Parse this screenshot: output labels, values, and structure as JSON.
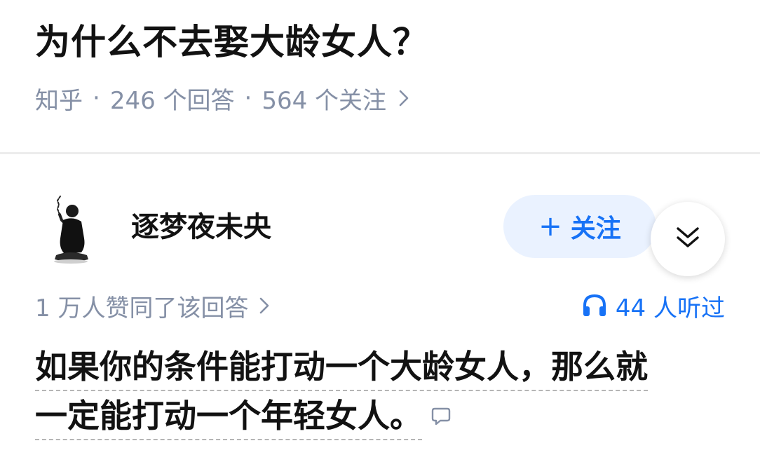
{
  "question": {
    "title": "为什么不去娶大龄女人？",
    "source": "知乎",
    "separator": "·",
    "answers_count": "246 个回答",
    "followers_count": "564 个关注",
    "chevron_icon": "chevron-right-icon"
  },
  "author": {
    "name": "逐梦夜未央",
    "avatar_icon": "avatar-silhouette",
    "follow_label": "关注",
    "follow_plus": "+"
  },
  "answer_meta": {
    "voteup_text": "1 万人赞同了该回答",
    "listen_text": "44 人听过",
    "listen_icon": "headphones-icon"
  },
  "answer": {
    "line1": "如果你的条件能打动一个大龄女人，那么就",
    "line2": "一定能打动一个年轻女人。",
    "comment_icon": "comment-bubble-icon"
  },
  "colors": {
    "accent": "#1772f6",
    "accent_bg": "#eaf2ff",
    "meta_gray": "#8590a6",
    "text": "#121212",
    "divider": "#ececec"
  }
}
